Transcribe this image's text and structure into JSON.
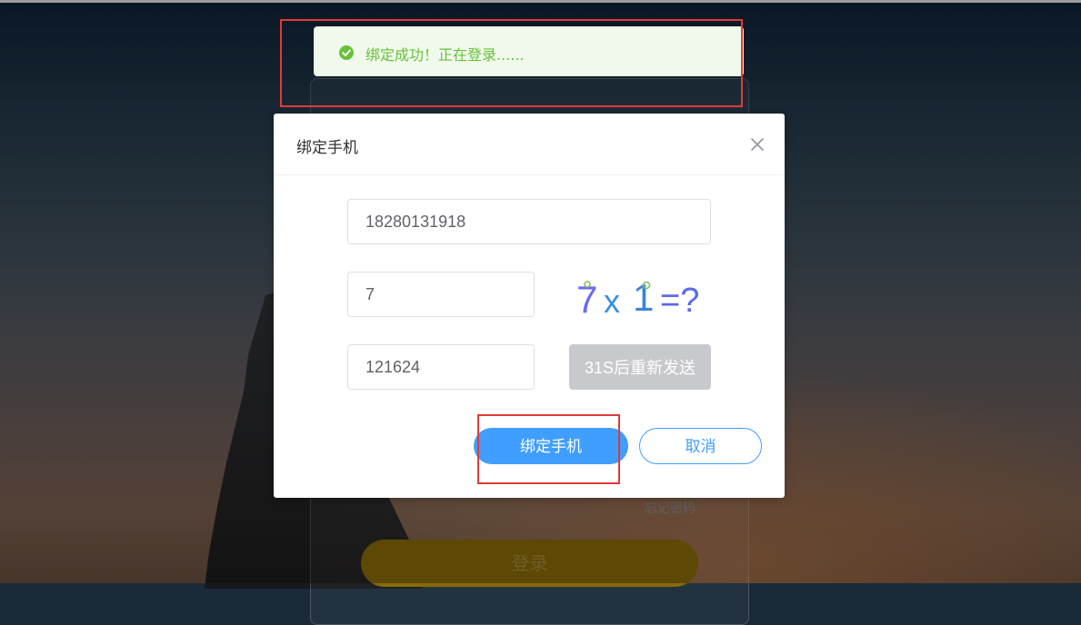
{
  "toast": {
    "icon": "check-circle-icon",
    "message": "绑定成功！正在登录......",
    "color": "#67c23a"
  },
  "dialog": {
    "title": "绑定手机",
    "close_icon": "close-icon",
    "phone": {
      "value": "18280131918"
    },
    "captcha_answer": {
      "value": "7"
    },
    "captcha_image": {
      "text": "7x1=?",
      "parts": [
        "7",
        "x",
        "1",
        "=?"
      ]
    },
    "sms_code": {
      "value": "121624"
    },
    "send_button": {
      "label": "31S后重新发送"
    },
    "bind_button": {
      "label": "绑定手机"
    },
    "cancel_button": {
      "label": "取消"
    }
  },
  "login_page": {
    "forgot_password": "忘记密码",
    "login_button": "登录"
  },
  "colors": {
    "primary": "#409eff",
    "success": "#67c23a",
    "highlight": "#e03a3a",
    "disabled": "#c8c9cc"
  }
}
